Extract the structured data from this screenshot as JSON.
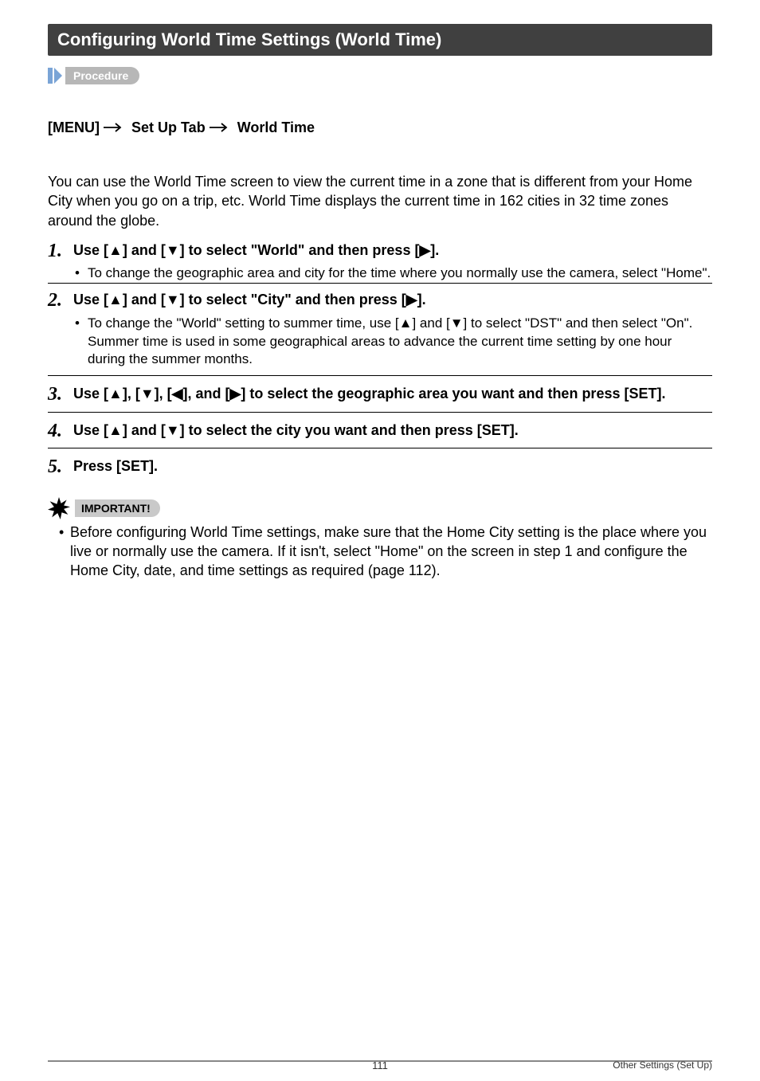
{
  "header": "Configuring World Time Settings (World Time)",
  "procedure_label": "Procedure",
  "menu_path": {
    "p1": "[MENU] ",
    "p2": " Set Up Tab ",
    "p3": " World Time"
  },
  "intro": "You can use the World Time screen to view the current time in a zone that is different from your Home City when you go on a trip, etc. World Time displays the current time in 162 cities in 32 time zones around the globe.",
  "steps": [
    {
      "num": "1.",
      "title_parts": [
        "Use [",
        "▲",
        "] and [",
        "▼",
        "] to select \"World\" and then press [",
        "▶",
        "]."
      ],
      "bullets": [
        "To change the geographic area and city for the time where you normally use the camera, select \"Home\"."
      ]
    },
    {
      "num": "2.",
      "title_parts": [
        "Use [",
        "▲",
        "] and [",
        "▼",
        "] to select \"City\" and then press [",
        "▶",
        "]."
      ],
      "bullets": [
        "To change the \"World\" setting to summer time, use [▲] and [▼] to select \"DST\" and then select \"On\". Summer time is used in some geographical areas to advance the current time setting by one hour during the summer months."
      ]
    },
    {
      "num": "3.",
      "title_parts": [
        "Use [",
        "▲",
        "], [",
        "▼",
        "], [",
        "◀",
        "], and [",
        "▶",
        "] to select the geographic area you want and then press [SET]."
      ],
      "bullets": []
    },
    {
      "num": "4.",
      "title_parts": [
        "Use [",
        "▲",
        "] and [",
        "▼",
        "] to select the city you want and then press [SET]."
      ],
      "bullets": []
    },
    {
      "num": "5.",
      "title_parts": [
        "Press [SET]."
      ],
      "bullets": []
    }
  ],
  "important_label": "IMPORTANT!",
  "important_note": "Before configuring World Time settings, make sure that the Home City setting is the place where you live or normally use the camera. If it isn't, select \"Home\" on the screen in step 1 and configure the Home City, date, and time settings as required (page 112).",
  "footer": {
    "page": "111",
    "section": "Other Settings (Set Up)"
  }
}
